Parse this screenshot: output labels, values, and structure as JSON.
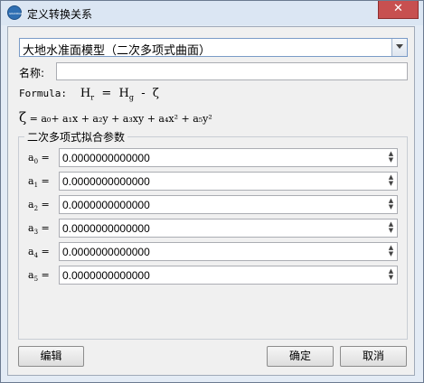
{
  "window": {
    "title": "定义转换关系",
    "close_glyph": "✕",
    "icon_text": "GRANDAR"
  },
  "model": {
    "selected": "大地水准面模型（二次多项式曲面）"
  },
  "name_field": {
    "label": "名称:",
    "value": ""
  },
  "formula": {
    "label": "Formula:",
    "hr": "H",
    "hr_sub": "r",
    "eq": "=",
    "hg": "H",
    "hg_sub": "g",
    "minus": "-",
    "zeta": "ζ"
  },
  "polynomial": {
    "zeta": "ζ",
    "expr": "= a₀+ a₁x + a₂y + a₃xy + a₄x² + a₅y²"
  },
  "params_group": {
    "title": "二次多项式拟合参数",
    "params": [
      {
        "name": "a",
        "sub": "0",
        "eq": "=",
        "value": "0.0000000000000"
      },
      {
        "name": "a",
        "sub": "1",
        "eq": "=",
        "value": "0.0000000000000"
      },
      {
        "name": "a",
        "sub": "2",
        "eq": "=",
        "value": "0.0000000000000"
      },
      {
        "name": "a",
        "sub": "3",
        "eq": "=",
        "value": "0.0000000000000"
      },
      {
        "name": "a",
        "sub": "4",
        "eq": "=",
        "value": "0.0000000000000"
      },
      {
        "name": "a",
        "sub": "5",
        "eq": "=",
        "value": "0.0000000000000"
      }
    ]
  },
  "buttons": {
    "edit": "编辑",
    "ok": "确定",
    "cancel": "取消"
  }
}
